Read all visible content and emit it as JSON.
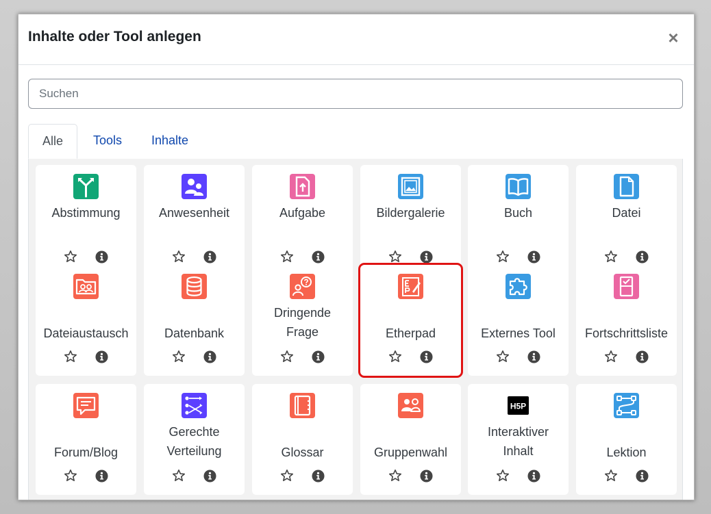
{
  "modal": {
    "title": "Inhalte oder Tool anlegen",
    "close_label": "×"
  },
  "search": {
    "placeholder": "Suchen",
    "value": ""
  },
  "tabs": [
    {
      "label": "Alle",
      "active": true
    },
    {
      "label": "Tools",
      "active": false
    },
    {
      "label": "Inhalte",
      "active": false
    }
  ],
  "colors": {
    "green": "#11a676",
    "purple": "#5b40ff",
    "pink": "#eb66a2",
    "blue": "#399be2",
    "red": "#f7634d",
    "black": "#000000",
    "highlight": "#e01414",
    "link": "#0f47ad"
  },
  "items": [
    {
      "name": "Abstimmung",
      "icon": "choice-icon"
    },
    {
      "name": "Anwesenheit",
      "icon": "attendance-icon"
    },
    {
      "name": "Aufgabe",
      "icon": "assignment-icon"
    },
    {
      "name": "Bildergalerie",
      "icon": "gallery-icon"
    },
    {
      "name": "Buch",
      "icon": "book-icon"
    },
    {
      "name": "Datei",
      "icon": "file-icon"
    },
    {
      "name": "Dateiaustausch",
      "icon": "file-exchange-icon"
    },
    {
      "name": "Datenbank",
      "icon": "database-icon"
    },
    {
      "name_line1": "Dringende",
      "name_line2": "Frage",
      "icon": "urgent-question-icon"
    },
    {
      "name": "Etherpad",
      "icon": "etherpad-icon"
    },
    {
      "name": "Externes Tool",
      "icon": "puzzle-icon"
    },
    {
      "name": "Fortschrittsliste",
      "icon": "checklist-icon"
    },
    {
      "name": "Forum/Blog",
      "icon": "forum-icon"
    },
    {
      "name_line1": "Gerechte",
      "name_line2": "Verteilung",
      "icon": "distribution-icon"
    },
    {
      "name": "Glossar",
      "icon": "glossary-icon"
    },
    {
      "name": "Gruppenwahl",
      "icon": "group-choice-icon"
    },
    {
      "name_line1": "Interaktiver",
      "name_line2": "Inhalt",
      "icon": "h5p-icon",
      "icon_text": "H5P"
    },
    {
      "name": "Lektion",
      "icon": "lesson-icon"
    }
  ]
}
